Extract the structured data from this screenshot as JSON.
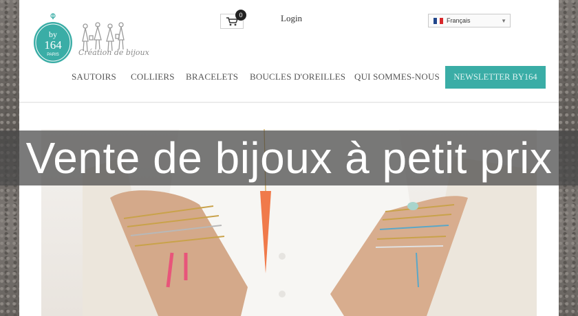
{
  "logo": {
    "badge_top": "by",
    "badge_num": "164",
    "badge_city": "PARIS",
    "tagline": "Création de bijoux"
  },
  "cart": {
    "count": "0"
  },
  "header": {
    "login_label": "Login"
  },
  "language": {
    "selected": "Français"
  },
  "nav": {
    "items": [
      "SAUTOIRS",
      "COLLIERS",
      "BRACELETS",
      "BOUCLES D'OREILLES",
      "QUI SOMMES-NOUS"
    ],
    "newsletter": "NEWSLETTER BY164"
  },
  "hero": {
    "title": "Vente de bijoux à petit prix"
  },
  "colors": {
    "accent": "#3aada6",
    "overlay": "#464646"
  },
  "icons": [
    "cart-icon",
    "france-flag-icon",
    "dropdown-caret-icon",
    "logo-badge-icon",
    "silhouettes-icon"
  ]
}
